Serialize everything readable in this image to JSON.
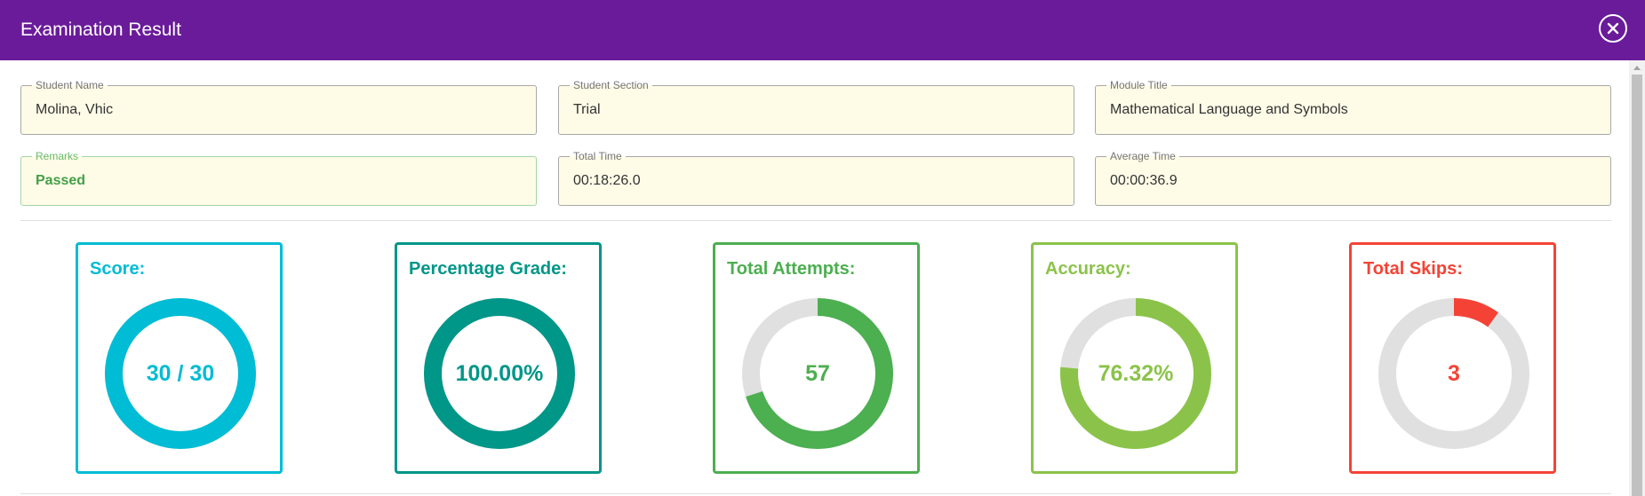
{
  "header": {
    "title": "Examination Result"
  },
  "fields": {
    "student_name": {
      "label": "Student Name",
      "value": "Molina, Vhic"
    },
    "student_section": {
      "label": "Student Section",
      "value": "Trial"
    },
    "module_title": {
      "label": "Module Title",
      "value": "Mathematical Language and Symbols"
    },
    "remarks": {
      "label": "Remarks",
      "value": "Passed"
    },
    "total_time": {
      "label": "Total Time",
      "value": "00:18:26.0"
    },
    "average_time": {
      "label": "Average Time",
      "value": "00:00:36.9"
    }
  },
  "cards": [
    {
      "title": "Score:",
      "display": "30 / 30",
      "fraction": 1.0,
      "color": "#00bcd4"
    },
    {
      "title": "Percentage Grade:",
      "display": "100.00%",
      "fraction": 1.0,
      "color": "#009688"
    },
    {
      "title": "Total Attempts:",
      "display": "57",
      "fraction": 0.7,
      "color": "#4caf50"
    },
    {
      "title": "Accuracy:",
      "display": "76.32%",
      "fraction": 0.7632,
      "color": "#8bc34a"
    },
    {
      "title": "Total Skips:",
      "display": "3",
      "fraction": 0.1,
      "color": "#f44336"
    }
  ],
  "colors": {
    "header": "#6a1b9a",
    "ring_track": "#e0e0e0",
    "field_bg": "#fefbe7"
  },
  "icons": {
    "close": "close-icon"
  }
}
